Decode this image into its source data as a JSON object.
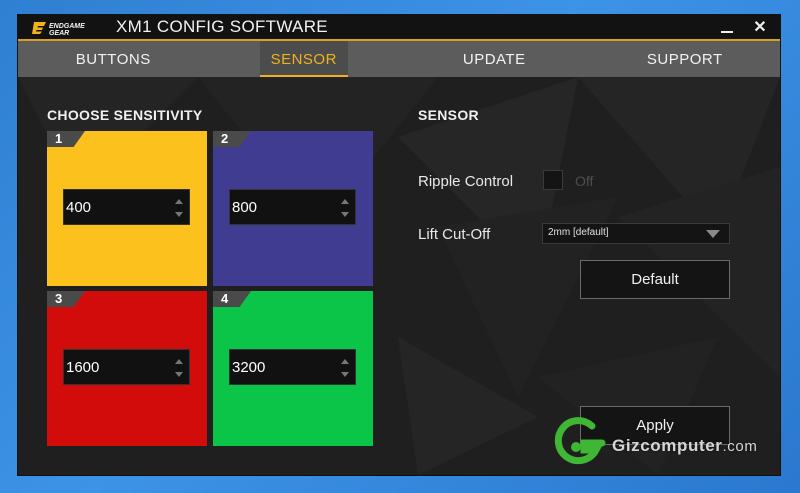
{
  "window": {
    "brand": "ENDGAME GEAR",
    "title": "XM1 CONFIG SOFTWARE",
    "minimize_icon": "minimize-icon",
    "close_icon": "close-icon",
    "close_glyph": "✕"
  },
  "tabs": [
    {
      "label": "BUTTONS",
      "active": false
    },
    {
      "label": "SENSOR",
      "active": true
    },
    {
      "label": "UPDATE",
      "active": false
    },
    {
      "label": "SUPPORT",
      "active": false
    }
  ],
  "sensitivity": {
    "title": "CHOOSE SENSITIVITY",
    "tiles": [
      {
        "number": "1",
        "value": "400",
        "color": "#fdc11e"
      },
      {
        "number": "2",
        "value": "800",
        "color": "#3f3c92"
      },
      {
        "number": "3",
        "value": "1600",
        "color": "#d20b0b"
      },
      {
        "number": "4",
        "value": "3200",
        "color": "#0ac547"
      }
    ]
  },
  "sensor": {
    "title": "SENSOR",
    "ripple_label": "Ripple Control",
    "ripple_state": "Off",
    "liftoff_label": "Lift Cut-Off",
    "liftoff_value": "2mm [default]",
    "default_button": "Default",
    "apply_button": "Apply"
  },
  "watermark": {
    "text": "Gizcomputer",
    "suffix": ".com",
    "accent": "#3fb634"
  },
  "colors": {
    "accent": "#f0b21c",
    "background": "#1f1f1f",
    "tabbar": "#5c5c5c"
  }
}
